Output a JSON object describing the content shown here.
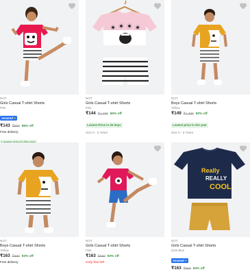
{
  "products": [
    {
      "brand": "NOT",
      "title": "Girls Casual T-shirt Shorts",
      "color": "Pink",
      "assured": true,
      "price": "₹143",
      "mrp": "₹999",
      "off": "85% off",
      "delivery": "Free delivery",
      "badge": "Lowest price in the year",
      "size": "",
      "stock": ""
    },
    {
      "brand": "NOT",
      "title": "Girls Casual T-shirt Shorts",
      "color": "Pink",
      "assured": false,
      "price": "₹144",
      "mrp": "₹1,499",
      "off": "90% off",
      "delivery": "",
      "badge": "Lowest Price in 30 days",
      "size": "Size 5 - 6 Years",
      "stock": ""
    },
    {
      "brand": "NOT",
      "title": "Boys Casual T-shirt Shorts",
      "color": "Yellow",
      "assured": false,
      "price": "₹149",
      "mrp": "₹1,499",
      "off": "90% off",
      "delivery": "",
      "badge": "Lowest price in the year",
      "size": "Size 5 - 6 Years",
      "stock": ""
    },
    {
      "brand": "NOT",
      "title": "Boys Casual T-shirt Shorts",
      "color": "Yellow",
      "assured": false,
      "price": "₹163",
      "mrp": "₹999",
      "off": "83% off",
      "delivery": "Free delivery",
      "badge": "",
      "size": "",
      "stock": ""
    },
    {
      "brand": "NOT",
      "title": "Girls Casual T-shirt Shorts",
      "color": "Pink",
      "assured": false,
      "price": "₹163",
      "mrp": "₹999",
      "off": "83% off",
      "delivery": "",
      "badge": "",
      "size": "",
      "stock": "Only few left"
    },
    {
      "brand": "NOT",
      "title": "Girls Casual T-shirt Shorts",
      "color": "Dark Blue",
      "assured": true,
      "price": "₹163",
      "mrp": "₹999",
      "off": "83% off",
      "delivery": "",
      "badge": "",
      "size": "",
      "stock": ""
    }
  ],
  "assured_label": "Assured",
  "shirt_slogan": [
    "Really",
    "REALLY",
    "COOL"
  ],
  "colors": {
    "accent_blue": "#2874f0",
    "discount_green": "#388e3c",
    "image_bg": "#f1f2f4",
    "few_left_red": "#ff6161"
  }
}
